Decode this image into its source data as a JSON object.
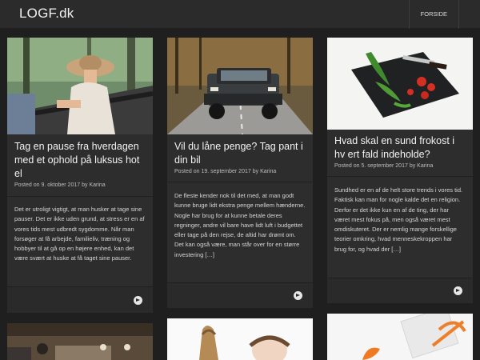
{
  "site": {
    "logo": "LOGF.dk"
  },
  "nav": {
    "items": [
      {
        "label": "FORSIDE"
      }
    ]
  },
  "posts": [
    {
      "title": "Tag en pause fra hverdagen med et ophold på luksus hot el",
      "meta_prefix": "Posted on",
      "date": "9. oktober 2017",
      "by": "by",
      "author": "Karina",
      "excerpt": "Det er utroligt vigtigt, at man husker at tage sine pauser. Det er ikke uden grund, at stress er en af vores tids mest udbredt sygdomme. Når man forsøger at få arbejde, familieliv, træning og hobbyer til at gå op en højere enhed, kan det være svært at huske at få taget sine pauser.",
      "image": "woman-in-hammock-photo"
    },
    {
      "title": "Vil du låne penge? Tag pant i din bil",
      "meta_prefix": "Posted on",
      "date": "19. september 2017",
      "by": "by",
      "author": "Karina",
      "excerpt": "De fleste kender nok til det med, at man godt kunne bruge lidt ekstra penge mellem hænderne. Nogle har brug for at kunne betale deres regninger, andre vil bare have lidt luft i budgettet eller tage på den rejse, de altid har drømt om. Det kan også være, man står over for en større investering […]",
      "image": "suv-on-road-photo"
    },
    {
      "title": "Hvad skal en sund frokost i hv ert fald indeholde?",
      "meta_prefix": "Posted on",
      "date": "5. september 2017",
      "by": "by",
      "author": "Karina",
      "excerpt": "Sundhed er en af de helt store trends i vores tid. Faktisk kan man for nogle kalde det en religion. Derfor er det ikke kun en af de ting, der har været mest fokus på, men også været mest omdiskuteret. Der er nemlig mange forskellige teorier omkring, hvad menneskekroppen har brug for, og hvad der […]",
      "image": "vegetables-on-board-photo"
    }
  ],
  "colors": {
    "background": "#1f1f1f",
    "topbar": "#2b2b2b",
    "card": "#2d2d2d",
    "text": "#e6e6e6"
  }
}
